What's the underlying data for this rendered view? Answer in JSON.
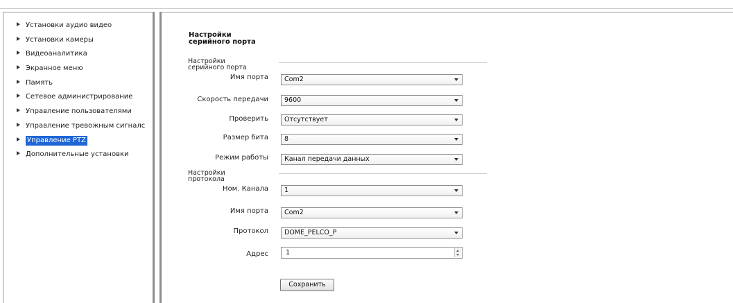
{
  "sidebar": {
    "items": [
      {
        "label": "Установки аудио видео"
      },
      {
        "label": "Установки камеры"
      },
      {
        "label": "Видеоаналитика"
      },
      {
        "label": "Экранное меню"
      },
      {
        "label": "Память"
      },
      {
        "label": "Сетевое администрирование"
      },
      {
        "label": "Управление пользователями"
      },
      {
        "label": "Управление тревожным сигналс"
      },
      {
        "label": "Управление PTZ",
        "active": true
      },
      {
        "label": "Дополнительные установки"
      }
    ]
  },
  "main": {
    "title_line1": "Настройки",
    "title_line2": "серийного порта",
    "serial_section": {
      "heading_line1": "Настройки",
      "heading_line2": "серийного порта",
      "fields": {
        "port_name": {
          "label": "Имя порта",
          "value": "Com2"
        },
        "baud_rate": {
          "label": "Скорость передачи",
          "value": "9600"
        },
        "parity": {
          "label": "Проверить",
          "value": "Отсутствует"
        },
        "data_bits": {
          "label": "Размер бита",
          "value": "8"
        },
        "work_mode": {
          "label": "Режим работы",
          "value": "Канал передачи данных"
        }
      }
    },
    "protocol_section": {
      "heading_line1": "Настройки",
      "heading_line2": "протокола",
      "fields": {
        "channel": {
          "label": "Ном. Канала",
          "value": "1"
        },
        "port_name": {
          "label": "Имя порта",
          "value": "Com2"
        },
        "protocol": {
          "label": "Протокол",
          "value": "DOME_PELCO_P"
        },
        "address": {
          "label": "Адрес",
          "value": "1"
        }
      }
    },
    "save_label": "Сохранить"
  },
  "colors": {
    "active_nav_bg": "#1f66d6",
    "panel_border": "#8c8c8c"
  },
  "icons": {
    "nav_arrow": "triangle-right-icon",
    "dropdown": "chevron-down-icon",
    "spinner": "spinner-arrows-icon"
  }
}
